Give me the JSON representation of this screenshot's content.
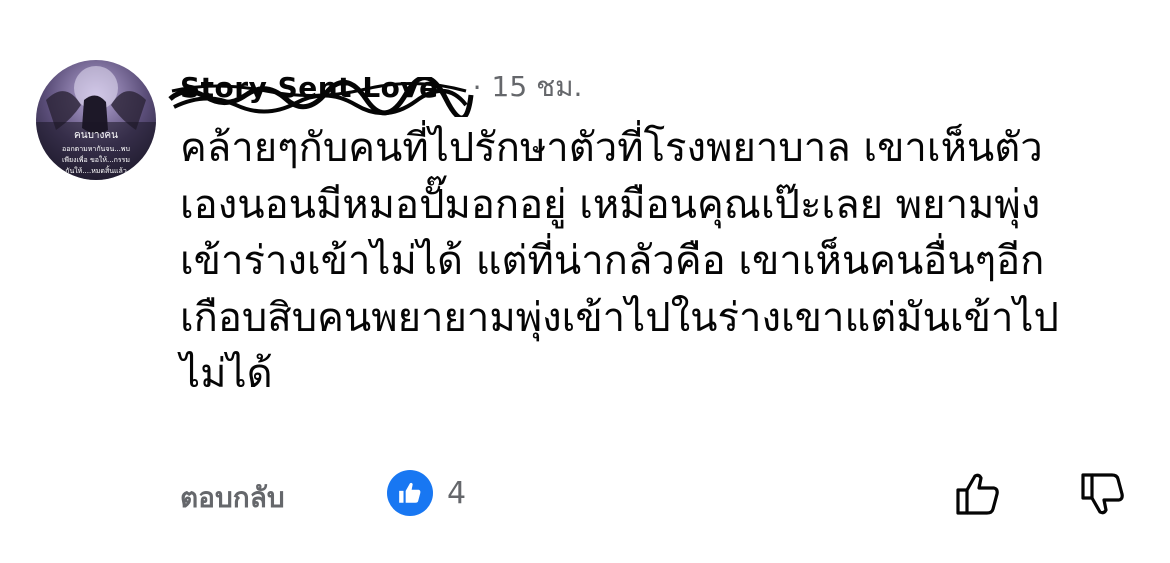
{
  "author": {
    "name": "Story Sent Love",
    "separator": "·",
    "time": "15 ชม."
  },
  "avatar": {
    "caption_title": "คนบางคน",
    "caption_lines": [
      "ออกตามหากันจน...พบ",
      "เพียงเพื่อ ขอให้...กรรม",
      "กันให้....หมดสิ้นแล้ว"
    ]
  },
  "comment": {
    "lines": [
      "คล้ายๆกับคนที่ไปรักษาตัวที่โรงพยาบาล เขาเห็นตัว",
      "เองนอนมีหมอปั๊มอกอยู่ เหมือนคุณเป๊ะเลย พยามพุ่ง",
      "เข้าร่างเข้าไม่ได้ แต่ที่น่ากลัวคือ เขาเห็นคนอื่นๆอีก",
      "เกือบสิบคนพยายามพุ่งเข้าไปในร่างเขาแต่มันเข้าไป",
      "ไม่ได้"
    ]
  },
  "actions": {
    "reply_label": "ตอบกลับ",
    "like_count": "4"
  },
  "colors": {
    "like_blue": "#1877f2",
    "meta_gray": "#65676b",
    "text": "#050505"
  }
}
